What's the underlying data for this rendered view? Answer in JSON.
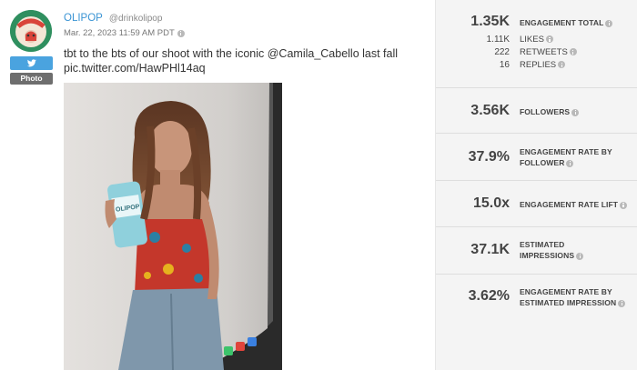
{
  "post": {
    "author_name": "OLIPOP",
    "author_handle": "@drinkolipop",
    "date": "Mar. 22, 2023 11:59 AM PDT",
    "text_line1": "tbt to the bts of our shoot with the iconic @Camila_Cabello last fall",
    "text_line2": "pic.twitter.com/HawPHl14aq",
    "badges": {
      "network_icon": "twitter-bird-icon",
      "media_type": "Photo"
    },
    "avatar_icon": "olipop-logo",
    "colors": {
      "link": "#3a94d4",
      "twitter": "#4aa3df",
      "badge_gray": "#6e6e6e",
      "avatar_bg": "#2f8f5f"
    }
  },
  "stats": {
    "engagement_total": {
      "value": "1.35K",
      "label": "ENGAGEMENT TOTAL"
    },
    "breakdown": [
      {
        "value": "1.11K",
        "label": "LIKES"
      },
      {
        "value": "222",
        "label": "RETWEETS"
      },
      {
        "value": "16",
        "label": "REPLIES"
      }
    ],
    "followers": {
      "value": "3.56K",
      "label": "FOLLOWERS"
    },
    "engagement_rate_follower": {
      "value": "37.9%",
      "label_line1": "ENGAGEMENT RATE BY",
      "label_line2": "FOLLOWER"
    },
    "engagement_rate_lift": {
      "value": "15.0x",
      "label": "ENGAGEMENT RATE LIFT"
    },
    "estimated_impressions": {
      "value": "37.1K",
      "label_line1": "ESTIMATED",
      "label_line2": "IMPRESSIONS"
    },
    "engagement_rate_impression": {
      "value": "3.62%",
      "label_line1": "ENGAGEMENT RATE BY",
      "label_line2": "ESTIMATED IMPRESSION"
    },
    "colors": {
      "panel_bg": "#f4f4f4",
      "text": "#444444",
      "divider": "#dedede"
    }
  }
}
